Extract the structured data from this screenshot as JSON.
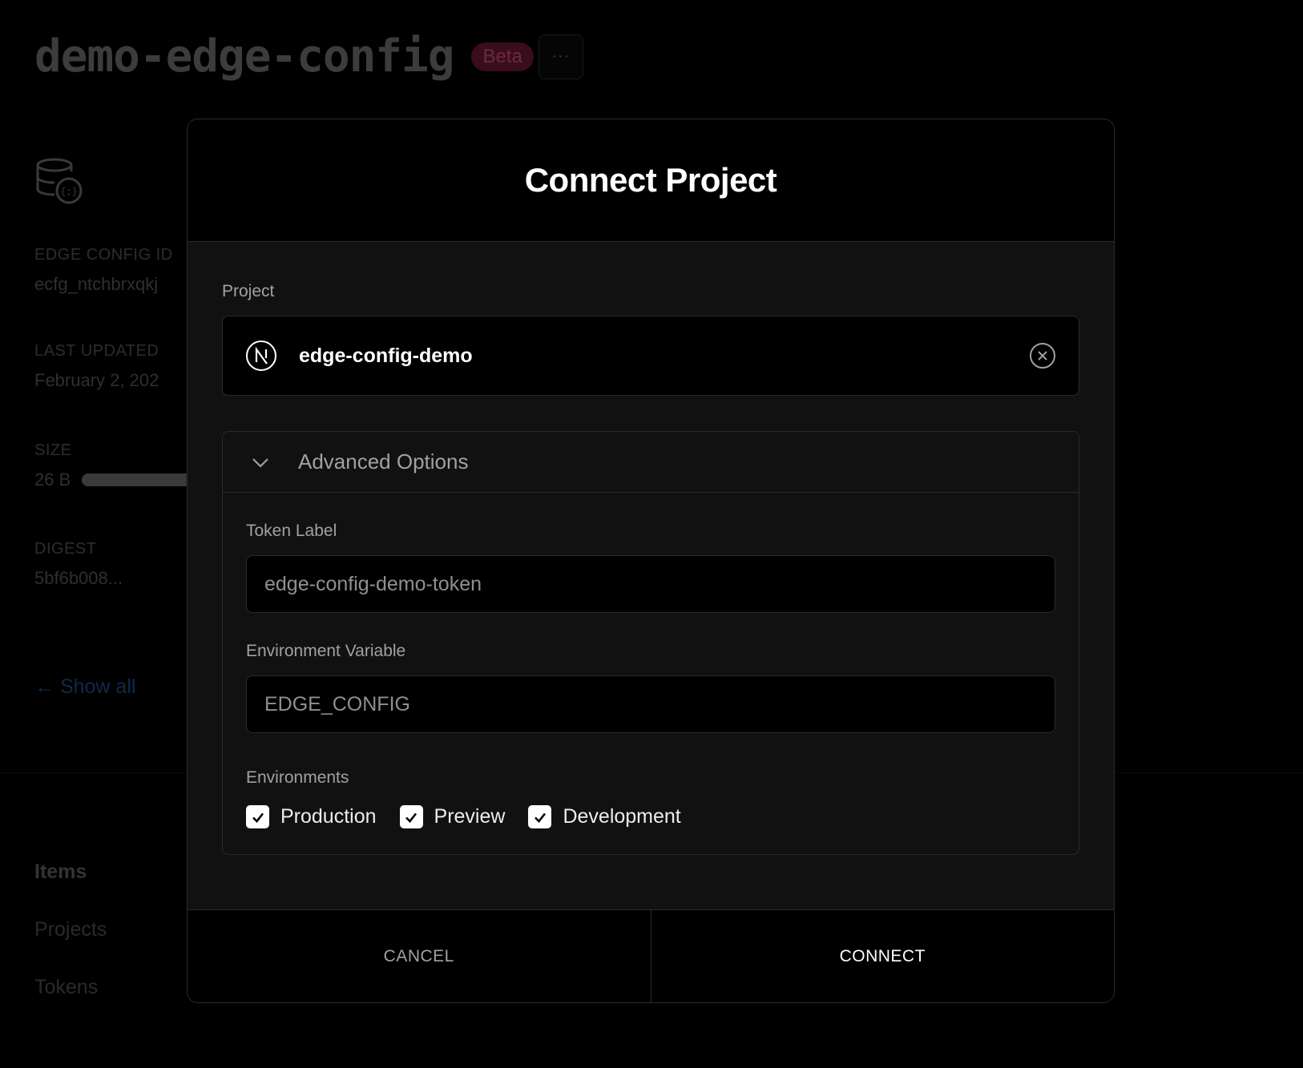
{
  "page": {
    "title": "demo-edge-config",
    "badge": "Beta",
    "more_label": "···",
    "meta": [
      {
        "label": "EDGE CONFIG ID",
        "value": "ecfg_ntchbrxqkj"
      },
      {
        "label": "LAST UPDATED",
        "value": "February 2, 202"
      },
      {
        "label": "SIZE",
        "value": "26 B"
      },
      {
        "label": "DIGEST",
        "value": "5bf6b008..."
      }
    ],
    "size_fill_fraction": 0.72,
    "show_all": "← Show all",
    "nav": [
      "Items",
      "Projects",
      "Tokens"
    ]
  },
  "modal": {
    "title": "Connect Project",
    "project_label": "Project",
    "project_name": "edge-config-demo",
    "advanced_title": "Advanced Options",
    "token_label": "Token Label",
    "token_placeholder": "edge-config-demo-token",
    "env_var_label": "Environment Variable",
    "env_var_placeholder": "EDGE_CONFIG",
    "environments_label": "Environments",
    "environments": [
      {
        "label": "Production",
        "checked": true
      },
      {
        "label": "Preview",
        "checked": true
      },
      {
        "label": "Development",
        "checked": true
      }
    ],
    "cancel_label": "CANCEL",
    "connect_label": "CONNECT"
  }
}
